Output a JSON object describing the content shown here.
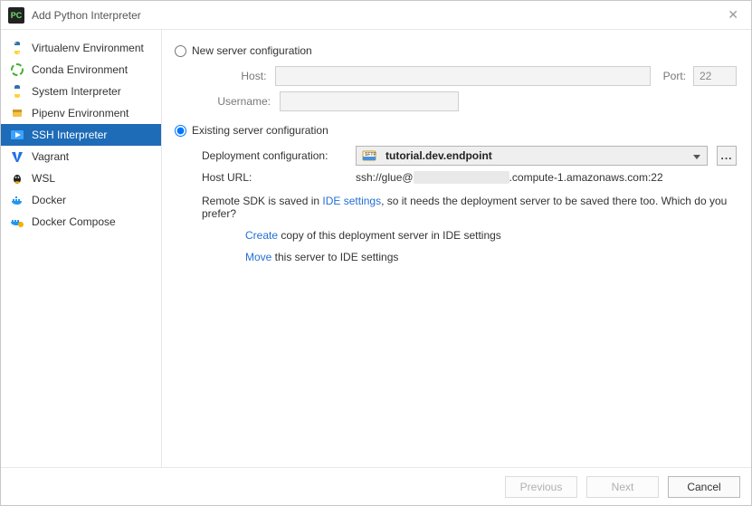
{
  "window": {
    "title": "Add Python Interpreter"
  },
  "sidebar": {
    "items": [
      {
        "label": "Virtualenv Environment"
      },
      {
        "label": "Conda Environment"
      },
      {
        "label": "System Interpreter"
      },
      {
        "label": "Pipenv Environment"
      },
      {
        "label": "SSH Interpreter"
      },
      {
        "label": "Vagrant"
      },
      {
        "label": "WSL"
      },
      {
        "label": "Docker"
      },
      {
        "label": "Docker Compose"
      }
    ]
  },
  "radio": {
    "new_label": "New server configuration",
    "existing_label": "Existing server configuration"
  },
  "new_config": {
    "host_label": "Host:",
    "host_value": "",
    "port_label": "Port:",
    "port_value": "22",
    "username_label": "Username:",
    "username_value": ""
  },
  "existing_config": {
    "deploy_label": "Deployment configuration:",
    "deploy_value": "tutorial.dev.endpoint",
    "ellipsis": "...",
    "hosturl_label": "Host URL:",
    "hosturl_prefix": "ssh://glue@",
    "hosturl_suffix": ".compute-1.amazonaws.com:22"
  },
  "info": {
    "text1": "Remote SDK is saved in ",
    "link1": "IDE settings",
    "text2": ", so it needs the deployment server to be saved there too. Which do you prefer?",
    "create_link": "Create",
    "create_text": " copy of this deployment server in IDE settings",
    "move_link": "Move",
    "move_text": " this server to IDE settings"
  },
  "footer": {
    "previous": "Previous",
    "next": "Next",
    "cancel": "Cancel"
  }
}
